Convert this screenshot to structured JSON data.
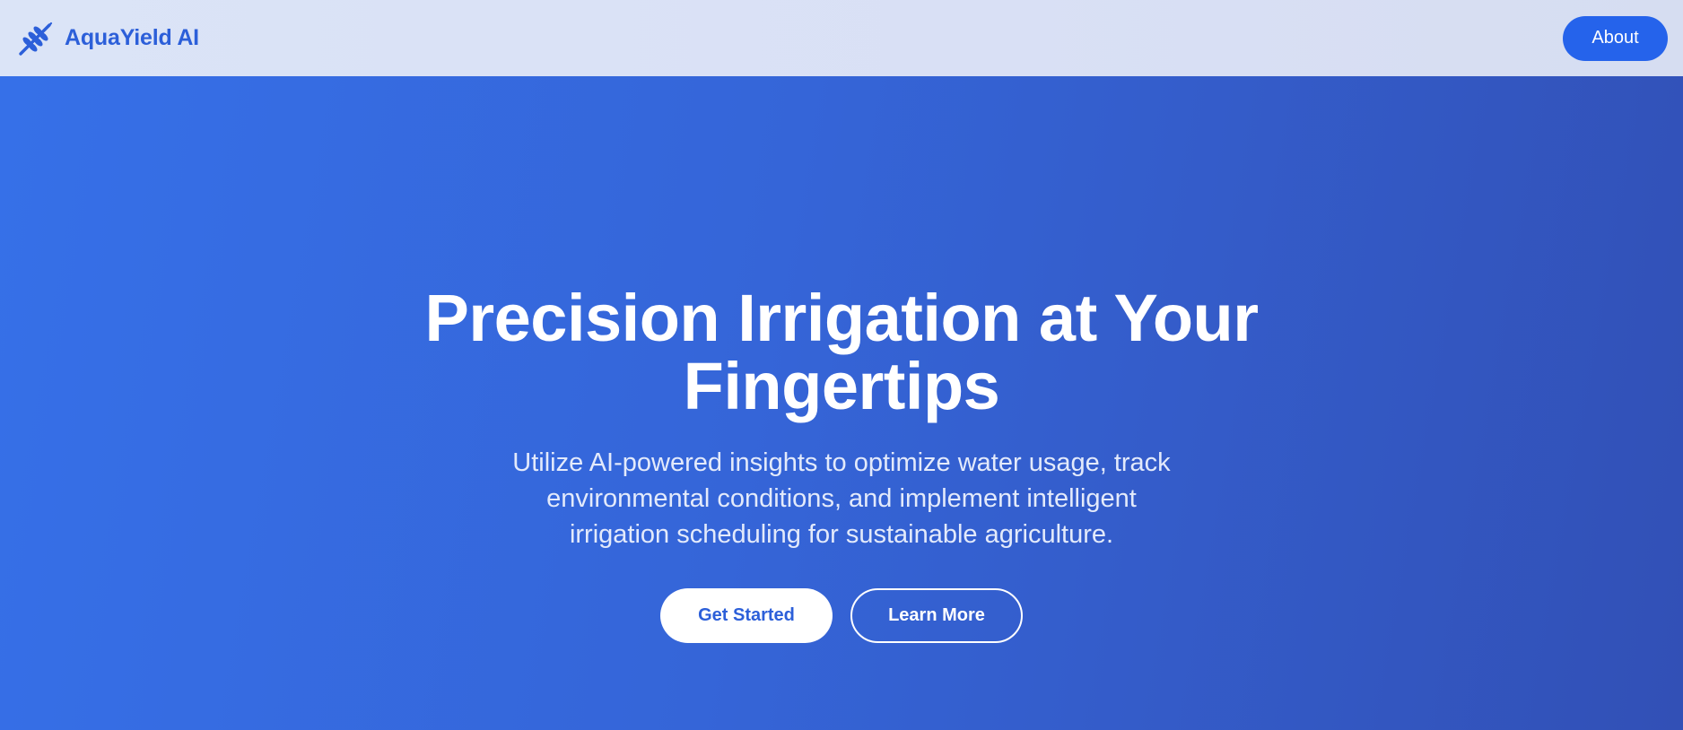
{
  "header": {
    "brand_name": "AquaYield AI",
    "brand_icon": "wheat-icon",
    "about_label": "About"
  },
  "hero": {
    "title_lines": [
      "Precision Irrigation at Your",
      "Fingertips"
    ],
    "subtitle_lines": [
      "Utilize AI-powered insights to optimize water usage, track",
      "environmental conditions, and implement intelligent",
      "irrigation scheduling for sustainable agriculture."
    ],
    "primary_cta": "Get Started",
    "secondary_cta": "Learn More"
  },
  "colors": {
    "accent": "#2563eb",
    "brand_text": "#2c5fd9",
    "hero_gradient_start": "#3670e8",
    "hero_gradient_end": "#3250b6",
    "header_background": "#dbe4f7"
  }
}
